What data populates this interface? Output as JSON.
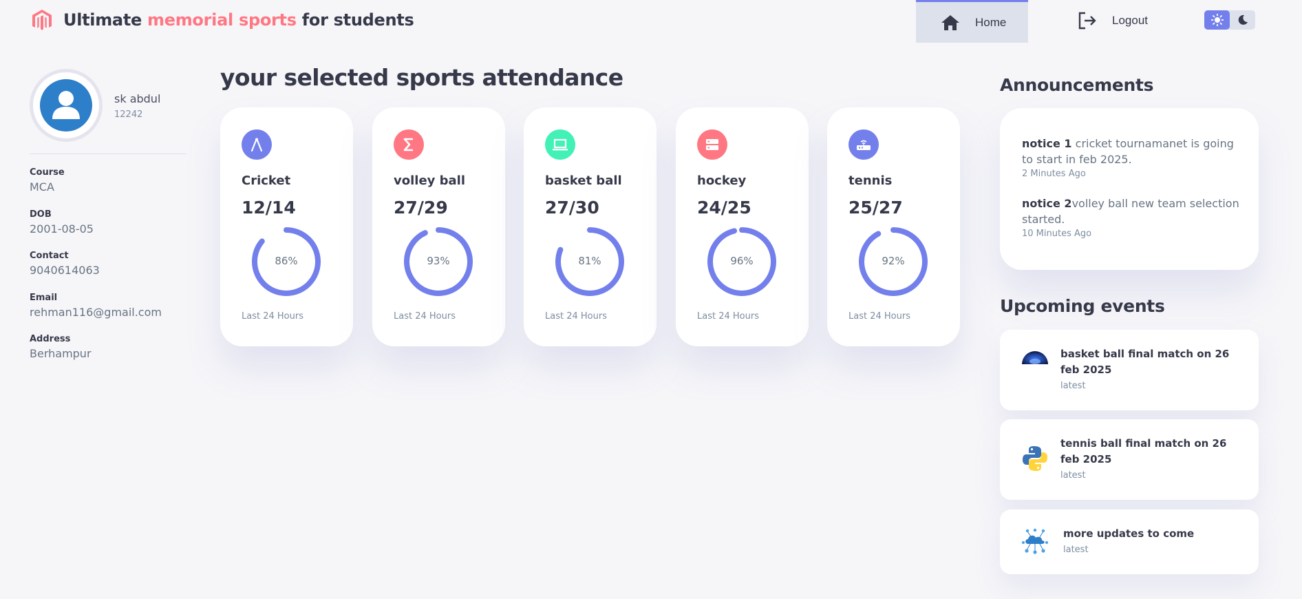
{
  "header": {
    "title_part1": "Ultimate ",
    "title_accent": "memorial sports",
    "title_part2": " for students",
    "nav": {
      "home": "Home",
      "logout": "Logout"
    },
    "theme": {
      "light_icon": "sun-icon",
      "dark_icon": "moon-icon",
      "active": "light"
    },
    "accent_color": "#ff7782"
  },
  "profile": {
    "name": "sk abdul",
    "id": "12242",
    "fields": [
      {
        "label": "Course",
        "value": "MCA"
      },
      {
        "label": "DOB",
        "value": "2001-08-05"
      },
      {
        "label": "Contact",
        "value": "9040614063"
      },
      {
        "label": "Email",
        "value": "rehman116@gmail.com"
      },
      {
        "label": "Address",
        "value": "Berhampur"
      }
    ]
  },
  "main": {
    "title": "your selected sports attendance",
    "cards": [
      {
        "name": "Cricket",
        "count": "12/14",
        "percent": 86,
        "percent_label": "86%",
        "footer": "Last 24 Hours",
        "icon": "compass-icon",
        "color": "#7380ec"
      },
      {
        "name": "volley ball",
        "count": "27/29",
        "percent": 93,
        "percent_label": "93%",
        "footer": "Last 24 Hours",
        "icon": "sigma-icon",
        "color": "#ff7782"
      },
      {
        "name": "basket ball",
        "count": "27/30",
        "percent": 81,
        "percent_label": "81%",
        "footer": "Last 24 Hours",
        "icon": "laptop-icon",
        "color": "#41f1b6"
      },
      {
        "name": "hockey",
        "count": "24/25",
        "percent": 96,
        "percent_label": "96%",
        "footer": "Last 24 Hours",
        "icon": "storage-icon",
        "color": "#ff7782"
      },
      {
        "name": "tennis",
        "count": "25/27",
        "percent": 92,
        "percent_label": "92%",
        "footer": "Last 24 Hours",
        "icon": "router-icon",
        "color": "#7380ec"
      }
    ],
    "gauge_color": "#7380ec"
  },
  "announcements": {
    "title": "Announcements",
    "items": [
      {
        "bold": "notice 1",
        "text": " cricket tournamanet is going to start in feb 2025.",
        "time": "2 Minutes Ago"
      },
      {
        "bold": "notice 2",
        "text": "volley ball new team selection started.",
        "time": "10 Minutes Ago"
      }
    ]
  },
  "events": {
    "title": "Upcoming events",
    "items": [
      {
        "title": "basket ball final match on 26 feb 2025",
        "sub": "latest",
        "icon": "stadium-icon"
      },
      {
        "title": "tennis ball final match on 26 feb 2025",
        "sub": "latest",
        "icon": "python-logo-icon"
      },
      {
        "title": "more updates to come",
        "sub": "latest",
        "icon": "cloud-network-icon"
      }
    ]
  }
}
